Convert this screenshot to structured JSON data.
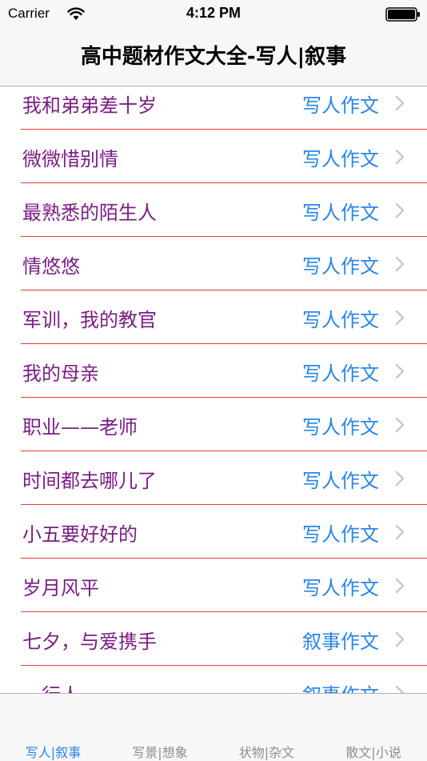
{
  "status_bar": {
    "carrier": "Carrier",
    "time": "4:12 PM",
    "wifi_icon": "wifi-icon",
    "battery_icon": "battery-icon"
  },
  "nav": {
    "title": "高中题材作文大全-写人|叙事"
  },
  "list": {
    "items": [
      {
        "title": "我和弟弟差十岁",
        "category": "写人作文"
      },
      {
        "title": "微微惜别情",
        "category": "写人作文"
      },
      {
        "title": "最熟悉的陌生人",
        "category": "写人作文"
      },
      {
        "title": "情悠悠",
        "category": "写人作文"
      },
      {
        "title": "军训，我的教官",
        "category": "写人作文"
      },
      {
        "title": "我的母亲",
        "category": "写人作文"
      },
      {
        "title": "职业——老师",
        "category": "写人作文"
      },
      {
        "title": "时间都去哪儿了",
        "category": "写人作文"
      },
      {
        "title": "小五要好好的",
        "category": "写人作文"
      },
      {
        "title": "岁月风平",
        "category": "写人作文"
      },
      {
        "title": "七夕，与爱携手",
        "category": "叙事作文"
      },
      {
        "title": "一行人",
        "category": "叙事作文"
      }
    ]
  },
  "tabs": [
    {
      "label": "写人|叙事",
      "active": true
    },
    {
      "label": "写景|想象",
      "active": false
    },
    {
      "label": "状物|杂文",
      "active": false
    },
    {
      "label": "散文|小说",
      "active": false
    }
  ],
  "colors": {
    "title_text": "#7a1e84",
    "category_text": "#2a86e8",
    "separator": "#e53935",
    "tab_active": "#2a86e8",
    "tab_inactive": "#8e8e8e"
  }
}
